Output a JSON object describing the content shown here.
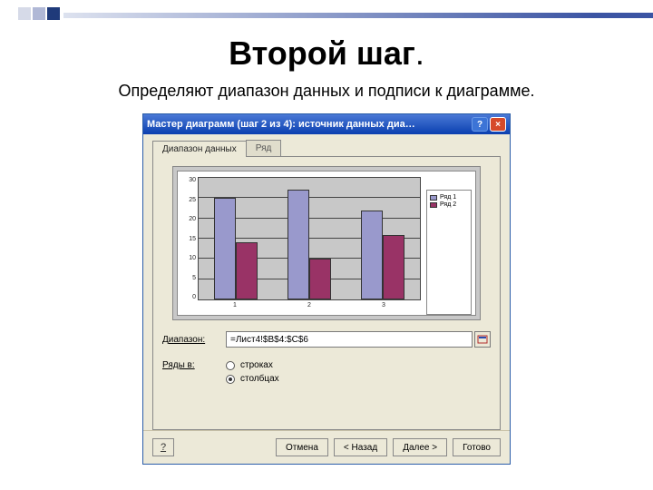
{
  "slide": {
    "title": "Второй шаг",
    "title_dot": ".",
    "subtitle": "Определяют диапазон данных и подписи к диаграмме."
  },
  "window": {
    "title": "Мастер диаграмм (шаг 2 из 4): источник данных диа…",
    "help": "?",
    "close": "×"
  },
  "tabs": [
    {
      "label": "Диапазон данных",
      "active": true
    },
    {
      "label": "Ряд",
      "active": false
    }
  ],
  "form": {
    "range_label": "Диапазон:",
    "range_value": "=Лист4!$B$4:$C$6",
    "rows_label": "Ряды в:",
    "radio_rows": "строках",
    "radio_cols": "столбцах"
  },
  "buttons": {
    "hint": "?",
    "cancel": "Отмена",
    "back": "< Назад",
    "next": "Далее >",
    "finish": "Готово"
  },
  "legend": {
    "s1": "Ряд 1",
    "s2": "Ряд 2"
  },
  "chart_data": {
    "type": "bar",
    "categories": [
      "1",
      "2",
      "3"
    ],
    "series": [
      {
        "name": "Ряд 1",
        "values": [
          25,
          27,
          22
        ]
      },
      {
        "name": "Ряд 2",
        "values": [
          14,
          10,
          16
        ]
      }
    ],
    "xlabel": "",
    "ylabel": "",
    "ylim": [
      0,
      30
    ],
    "y_ticks": [
      0,
      5,
      10,
      15,
      20,
      25,
      30
    ],
    "grid": true,
    "legend_position": "right"
  }
}
